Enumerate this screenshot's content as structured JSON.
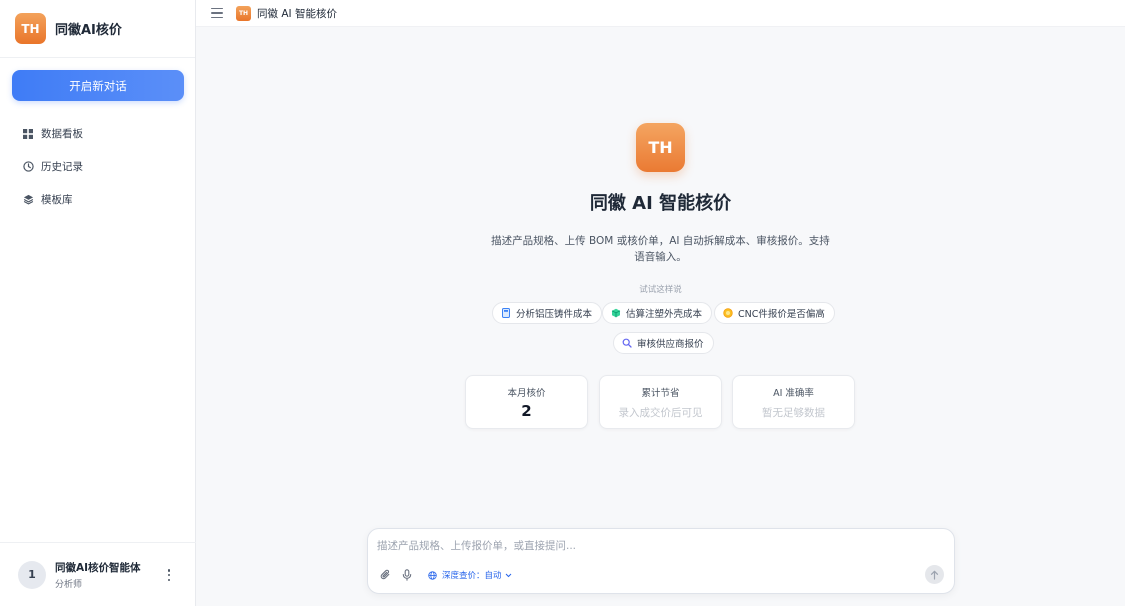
{
  "sidebar": {
    "logo_text": "TH",
    "brand_name": "同徽AI核价",
    "new_chat_label": "开启新对话",
    "items": [
      {
        "label": "数据看板",
        "icon": "dashboard-icon"
      },
      {
        "label": "历史记录",
        "icon": "clock-icon"
      },
      {
        "label": "模板库",
        "icon": "layers-icon"
      }
    ],
    "user": {
      "avatar_text": "1",
      "name": "同徽AI核价智能体",
      "role": "分析师"
    }
  },
  "topbar": {
    "logo_text": "TH",
    "title": "同徽 AI 智能核价"
  },
  "main": {
    "hero_logo_text": "TH",
    "title": "同徽 AI 智能核价",
    "description": "描述产品规格、上传 BOM 或核价单，AI 自动拆解成本、审核报价。支持语音输入。",
    "try_label": "试试这样说",
    "suggestions": [
      {
        "label": "分析铝压铸件成本",
        "icon": "calculator-icon",
        "color": "#3b82f6"
      },
      {
        "label": "估算注塑外壳成本",
        "icon": "box-icon",
        "color": "#10b981"
      },
      {
        "label": "CNC件报价是否偏高",
        "icon": "coin-icon",
        "color": "#f59e0b"
      },
      {
        "label": "审核供应商报价",
        "icon": "search-icon",
        "color": "#6366f1"
      }
    ],
    "stats": [
      {
        "label": "本月核价",
        "value": "2"
      },
      {
        "label": "累计节省",
        "value": "录入成交价后可见"
      },
      {
        "label": "AI 准确率",
        "value": "暂无足够数据"
      }
    ]
  },
  "composer": {
    "placeholder": "描述产品规格、上传报价单，或直接提问...",
    "mode_label": "深度查价：自动"
  },
  "colors": {
    "accent": "#3f7cf6",
    "brand_orange": "#ea7a33"
  }
}
